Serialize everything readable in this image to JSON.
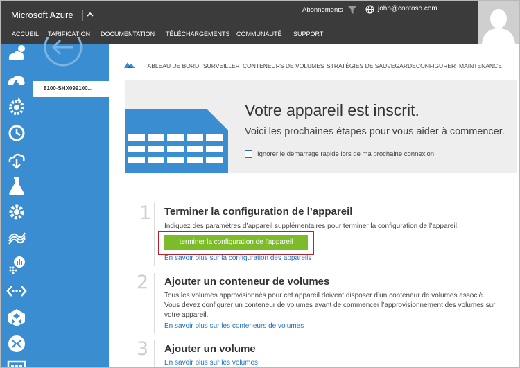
{
  "header": {
    "brand": "Microsoft Azure",
    "subscriptions_label": "Abonnements",
    "user_email": "john@contoso.com",
    "nav": [
      "ACCUEIL",
      "TARIFICATION",
      "DOCUMENTATION",
      "TÉLÉCHARGEMENTS",
      "COMMUNAUTÉ",
      "SUPPORT"
    ]
  },
  "sidebar": {
    "icons": [
      "weather-icon",
      "storm-icon",
      "gear-badge-icon",
      "clock-icon",
      "cloud-download-icon",
      "flask-icon",
      "settings-icon",
      "storsimple-icon",
      "chart-icon",
      "network-icon",
      "puzzle-icon",
      "arrows-icon",
      "server-icon"
    ],
    "device": "8100-SHX099100..."
  },
  "tabs": [
    "TABLEAU DE BORD",
    "SURVEILLER",
    "CONTENEURS DE VOLUMES",
    "STRATÉGIES DE SAUVEGARDE",
    "CONFIGURER",
    "MAINTENANCE"
  ],
  "banner": {
    "title": "Votre appareil est inscrit.",
    "subtitle": "Voici les prochaines étapes pour vous aider à commencer.",
    "checkbox_label": "Ignorer le démarrage rapide lors de ma prochaine connexion",
    "checkbox_checked": false
  },
  "steps": [
    {
      "number": "1",
      "title": "Terminer la configuration de l’appareil",
      "description": "Indiquez des paramètres d’appareil supplémentaires pour terminer la configuration de l’appareil.",
      "button": "terminer la configuration de l'appareil",
      "link": "En savoir plus sur la configuration des appareils"
    },
    {
      "number": "2",
      "title": "Ajouter un conteneur de volumes",
      "description": "Tous les volumes approvisionnés pour cet appareil doivent disposer d’un conteneur de volumes associé. Vous devez configurer un conteneur de volumes avant de commencer l’approvisionnement des volumes sur votre appareil.",
      "link": "En savoir plus sur les conteneurs de volumes"
    },
    {
      "number": "3",
      "title": "Ajouter un volume",
      "link": "En savoir plus sur les volumes"
    }
  ],
  "colors": {
    "header_bg": "#3b3b3b",
    "sidebar_bg": "#3a8dd0",
    "button_green": "#7dbb2b",
    "highlight_red": "#b7222a",
    "link_blue": "#1f71c1"
  }
}
